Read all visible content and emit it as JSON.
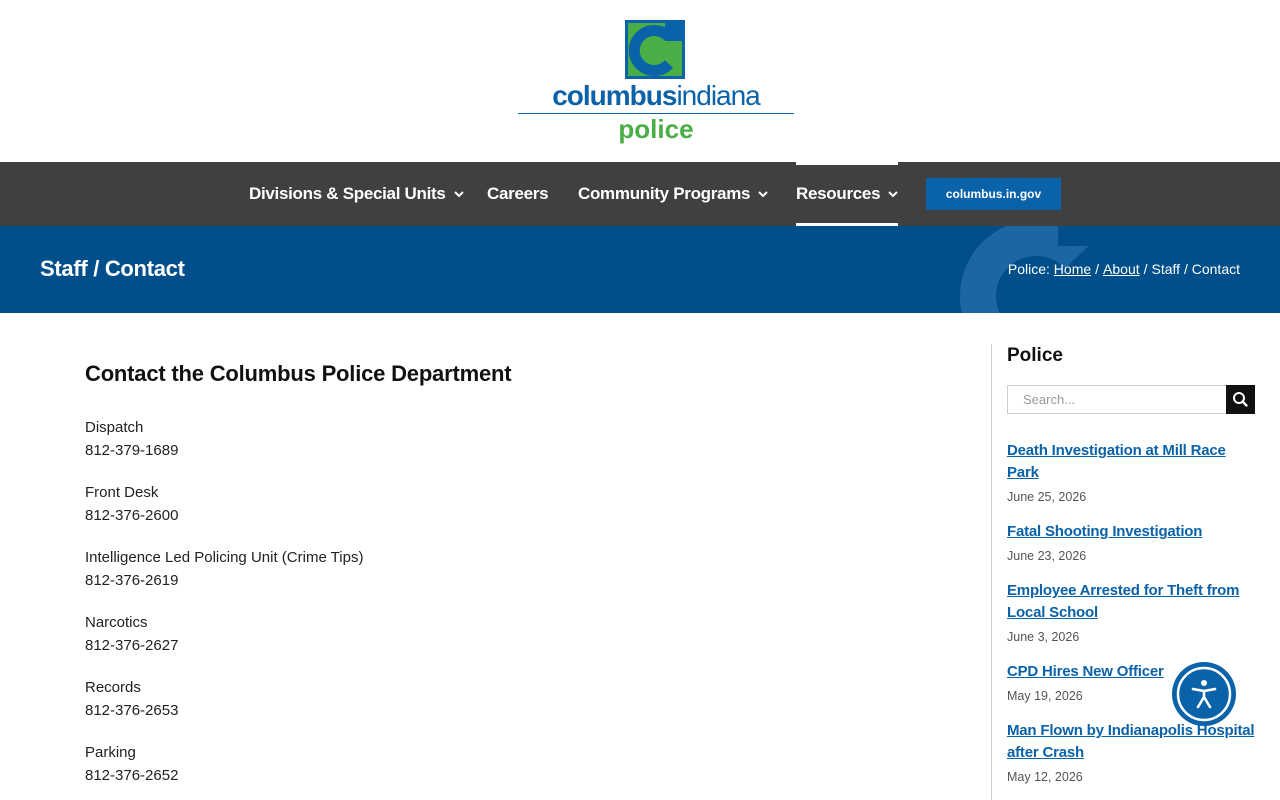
{
  "brand": {
    "word_bold": "columbus",
    "word_light": "indiana",
    "sub": "police",
    "colors": {
      "blue": "#0a62a9",
      "green": "#4aae46",
      "navy_band": "#004e8a",
      "nav_bg": "#404040"
    }
  },
  "nav": {
    "items": [
      {
        "label": "Divisions & Special Units",
        "has_menu": true
      },
      {
        "label": "Careers",
        "has_menu": false
      },
      {
        "label": "Community Programs",
        "has_menu": true
      },
      {
        "label": "Resources",
        "has_menu": true,
        "active": true
      }
    ],
    "cta": "columbus.in.gov"
  },
  "page": {
    "title": "Staff / Contact",
    "breadcrumb": {
      "prefix": "Police:",
      "home": "Home",
      "sep": "/",
      "about": "About",
      "current": "Staff / Contact"
    }
  },
  "main": {
    "heading": "Contact the Columbus Police Department",
    "contacts": [
      {
        "label": "Dispatch",
        "phone": "812-379-1689"
      },
      {
        "label": "Front Desk",
        "phone": "812-376-2600"
      },
      {
        "label": "Intelligence Led Policing Unit (Crime Tips)",
        "phone": "812-376-2619"
      },
      {
        "label": "Narcotics",
        "phone": "812-376-2627"
      },
      {
        "label": "Records",
        "phone": "812-376-2653"
      },
      {
        "label": "Parking",
        "phone": "812-376-2652"
      }
    ]
  },
  "sidebar": {
    "title": "Police",
    "search_placeholder": "Search...",
    "posts": [
      {
        "title": "Death Investigation at Mill Race Park",
        "date": "June 25, 2026"
      },
      {
        "title": "Fatal Shooting Investigation",
        "date": "June 23, 2026"
      },
      {
        "title": "Employee Arrested for Theft from Local School",
        "date": "June 3, 2026"
      },
      {
        "title": "CPD Hires New Officer",
        "date": "May 19, 2026"
      },
      {
        "title": "Man Flown by Indianapolis Hospital after Crash",
        "date": "May 12, 2026"
      }
    ]
  },
  "icons": {
    "search": "search-icon",
    "chevron": "chevron-down-icon",
    "accessibility": "accessibility-icon",
    "logo": "columbus-c-logo-icon"
  }
}
